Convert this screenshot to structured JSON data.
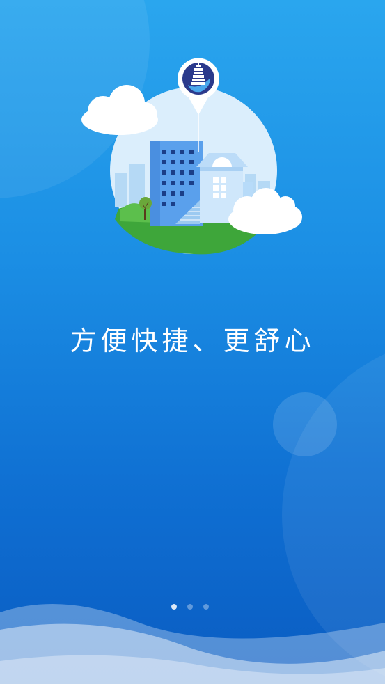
{
  "onboarding": {
    "headline": "方便快捷、更舒心",
    "page_indicator": {
      "total": 3,
      "active_index": 0
    }
  },
  "illustration": {
    "pin_icon": "pagoda-icon",
    "subjects": [
      "building-icon",
      "house-icon",
      "cloud-icon",
      "tree-icon"
    ]
  },
  "colors": {
    "background_top": "#2aa6ee",
    "background_bottom": "#0a5cc2",
    "pin_badge": "#2b3a8c",
    "grass": "#3ea63a"
  }
}
